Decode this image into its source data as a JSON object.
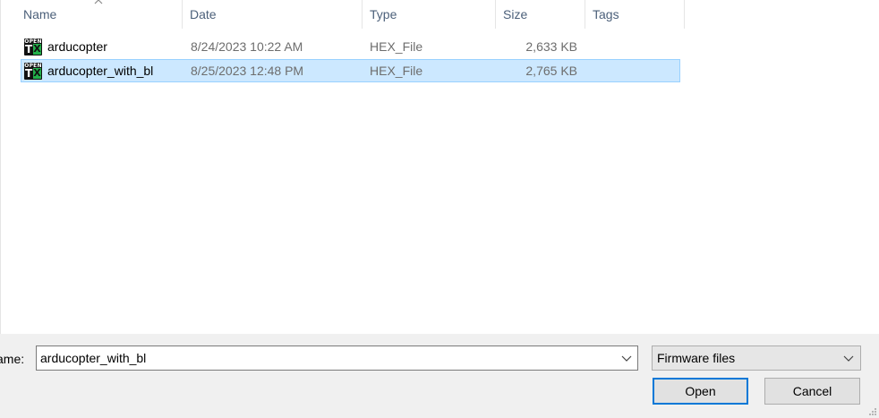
{
  "columns": {
    "name": "Name",
    "date": "Date",
    "type": "Type",
    "size": "Size",
    "tags": "Tags"
  },
  "sort": {
    "column": "name",
    "direction": "ascending",
    "icon": "sort-caret-up-icon"
  },
  "files": [
    {
      "icon": "opentx-file-icon",
      "name": "arducopter",
      "date": "8/24/2023 10:22 AM",
      "type": "HEX_File",
      "size": "2,633 KB",
      "selected": false
    },
    {
      "icon": "opentx-file-icon",
      "name": "arducopter_with_bl",
      "date": "8/25/2023 12:48 PM",
      "type": "HEX_File",
      "size": "2,765 KB",
      "selected": true
    }
  ],
  "icon_text": {
    "top": "OPEN",
    "t": "T",
    "x": "X"
  },
  "bottom": {
    "file_name_label": "ame:",
    "file_name_value": "arducopter_with_bl",
    "file_type_filter": "Firmware files",
    "open_label": "Open",
    "cancel_label": "Cancel"
  },
  "colors": {
    "header_text": "#4c607a",
    "selection_bg": "#cce8ff",
    "selection_border": "#99d1ff",
    "primary_button_border": "#0078d7",
    "panel_bg": "#f0f0f0",
    "icon_green": "#22b04a"
  }
}
